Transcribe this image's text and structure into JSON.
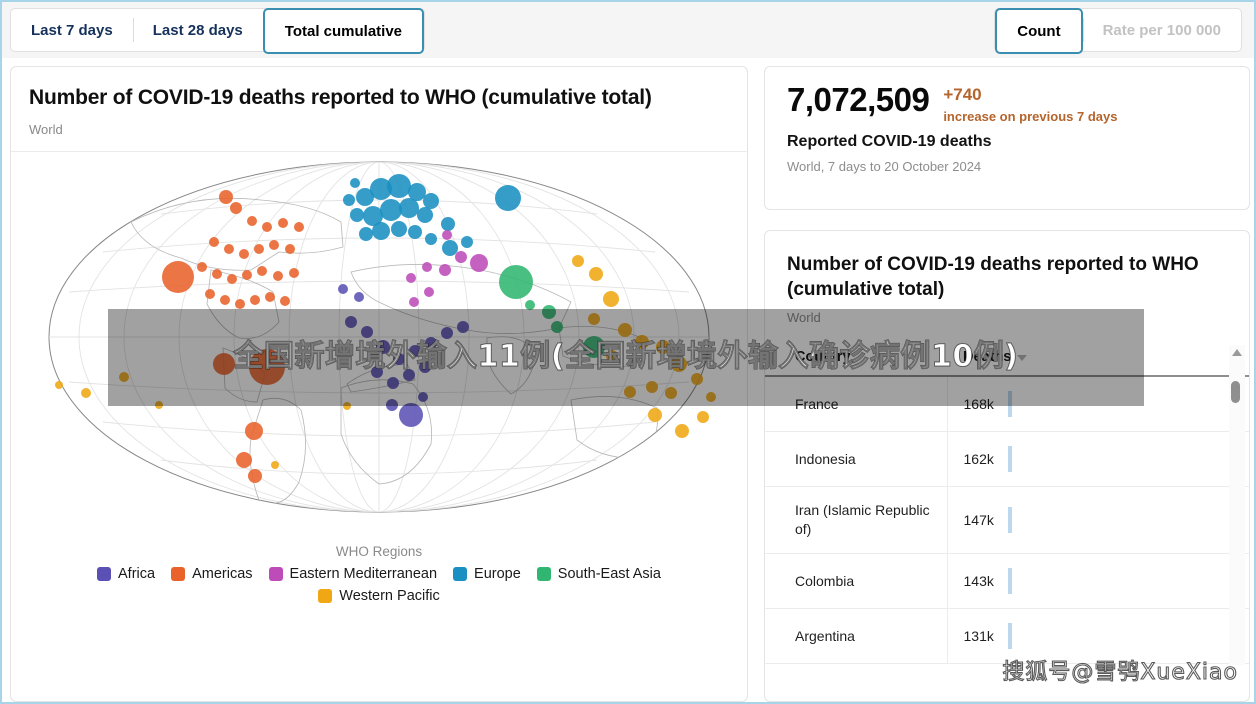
{
  "toolbar": {
    "period_tabs": [
      {
        "label": "Last 7 days",
        "active": false
      },
      {
        "label": "Last 28 days",
        "active": false
      },
      {
        "label": "Total cumulative",
        "active": true
      }
    ],
    "measure_tabs": [
      {
        "label": "Count",
        "active": true,
        "disabled": false
      },
      {
        "label": "Rate per 100 000",
        "active": false,
        "disabled": true
      }
    ]
  },
  "map_panel": {
    "title": "Number of COVID-19 deaths reported to WHO (cumulative total)",
    "subtitle": "World",
    "legend_title": "WHO Regions",
    "legend": [
      {
        "label": "Africa",
        "color": "#5b51b5"
      },
      {
        "label": "Americas",
        "color": "#e8622a"
      },
      {
        "label": "Eastern Mediterranean",
        "color": "#bd4cb8"
      },
      {
        "label": "Europe",
        "color": "#1a8fc1"
      },
      {
        "label": "South-East Asia",
        "color": "#31b671"
      },
      {
        "label": "Western Pacific",
        "color": "#efa713"
      }
    ]
  },
  "stat_panel": {
    "value": "7,072,509",
    "delta": "+740",
    "delta_note": "increase on previous 7 days",
    "label": "Reported COVID-19 deaths",
    "scope": "World, 7 days to 20 October 2024"
  },
  "table_panel": {
    "title": "Number of COVID-19 deaths reported to WHO (cumulative total)",
    "subtitle": "World",
    "columns": [
      "Country",
      "Deaths"
    ],
    "sort_column": "Deaths",
    "sort_direction": "descending",
    "rows": [
      {
        "country": "France",
        "deaths": "168k",
        "bar": 0.34
      },
      {
        "country": "Indonesia",
        "deaths": "162k",
        "bar": 0.33
      },
      {
        "country": "Iran (Islamic Republic of)",
        "deaths": "147k",
        "bar": 0.3
      },
      {
        "country": "Colombia",
        "deaths": "143k",
        "bar": 0.29
      },
      {
        "country": "Argentina",
        "deaths": "131k",
        "bar": 0.27
      }
    ]
  },
  "overlays": {
    "headline": "全国新增境外输入11例(全国新增境外输入确诊病例10例)",
    "watermark": "搜狐号@雪鸮XueXiao"
  },
  "chart_data": {
    "type": "scatter",
    "title": "Number of COVID-19 deaths reported to WHO (cumulative total)",
    "subtitle": "World",
    "projection": "orthographic-globe",
    "encoding": {
      "size": "cumulative deaths",
      "color": "WHO region"
    },
    "legend_position": "bottom",
    "grid": true,
    "series": [
      {
        "name": "Africa",
        "color": "#5b51b5"
      },
      {
        "name": "Americas",
        "color": "#e8622a"
      },
      {
        "name": "Eastern Mediterranean",
        "color": "#bd4cb8"
      },
      {
        "name": "Europe",
        "color": "#1a8fc1"
      },
      {
        "name": "South-East Asia",
        "color": "#31b671"
      },
      {
        "name": "Western Pacific",
        "color": "#efa713"
      }
    ],
    "points": [
      {
        "x": 191,
        "y": 188,
        "r": 20,
        "region": "Americas"
      },
      {
        "x": 167,
        "y": 350,
        "r": 16,
        "region": "Americas"
      },
      {
        "x": 215,
        "y": 270,
        "r": 7,
        "region": "Americas"
      },
      {
        "x": 256,
        "y": 440,
        "r": 18,
        "region": "Americas"
      },
      {
        "x": 213,
        "y": 437,
        "r": 11,
        "region": "Americas"
      },
      {
        "x": 243,
        "y": 504,
        "r": 9,
        "region": "Americas"
      },
      {
        "x": 233,
        "y": 533,
        "r": 8,
        "region": "Americas"
      },
      {
        "x": 244,
        "y": 549,
        "r": 7,
        "region": "Americas"
      },
      {
        "x": 225,
        "y": 281,
        "r": 6,
        "region": "Americas"
      },
      {
        "x": 241,
        "y": 294,
        "r": 5,
        "region": "Americas"
      },
      {
        "x": 256,
        "y": 300,
        "r": 5,
        "region": "Americas"
      },
      {
        "x": 272,
        "y": 296,
        "r": 5,
        "region": "Americas"
      },
      {
        "x": 288,
        "y": 300,
        "r": 5,
        "region": "Americas"
      },
      {
        "x": 203,
        "y": 315,
        "r": 5,
        "region": "Americas"
      },
      {
        "x": 218,
        "y": 322,
        "r": 5,
        "region": "Americas"
      },
      {
        "x": 233,
        "y": 327,
        "r": 5,
        "region": "Americas"
      },
      {
        "x": 248,
        "y": 322,
        "r": 5,
        "region": "Americas"
      },
      {
        "x": 263,
        "y": 318,
        "r": 5,
        "region": "Americas"
      },
      {
        "x": 279,
        "y": 322,
        "r": 5,
        "region": "Americas"
      },
      {
        "x": 191,
        "y": 340,
        "r": 5,
        "region": "Americas"
      },
      {
        "x": 206,
        "y": 347,
        "r": 5,
        "region": "Americas"
      },
      {
        "x": 221,
        "y": 352,
        "r": 5,
        "region": "Americas"
      },
      {
        "x": 236,
        "y": 348,
        "r": 5,
        "region": "Americas"
      },
      {
        "x": 251,
        "y": 344,
        "r": 5,
        "region": "Americas"
      },
      {
        "x": 267,
        "y": 349,
        "r": 5,
        "region": "Americas"
      },
      {
        "x": 283,
        "y": 346,
        "r": 5,
        "region": "Americas"
      },
      {
        "x": 199,
        "y": 367,
        "r": 5,
        "region": "Americas"
      },
      {
        "x": 214,
        "y": 373,
        "r": 5,
        "region": "Americas"
      },
      {
        "x": 229,
        "y": 377,
        "r": 5,
        "region": "Americas"
      },
      {
        "x": 244,
        "y": 373,
        "r": 5,
        "region": "Americas"
      },
      {
        "x": 259,
        "y": 370,
        "r": 5,
        "region": "Americas"
      },
      {
        "x": 274,
        "y": 374,
        "r": 5,
        "region": "Americas"
      },
      {
        "x": 354,
        "y": 270,
        "r": 9,
        "region": "Europe"
      },
      {
        "x": 370,
        "y": 262,
        "r": 11,
        "region": "Europe"
      },
      {
        "x": 388,
        "y": 259,
        "r": 12,
        "region": "Europe"
      },
      {
        "x": 406,
        "y": 265,
        "r": 9,
        "region": "Europe"
      },
      {
        "x": 420,
        "y": 274,
        "r": 8,
        "region": "Europe"
      },
      {
        "x": 362,
        "y": 289,
        "r": 10,
        "region": "Europe"
      },
      {
        "x": 380,
        "y": 283,
        "r": 11,
        "region": "Europe"
      },
      {
        "x": 398,
        "y": 281,
        "r": 10,
        "region": "Europe"
      },
      {
        "x": 414,
        "y": 288,
        "r": 8,
        "region": "Europe"
      },
      {
        "x": 346,
        "y": 288,
        "r": 7,
        "region": "Europe"
      },
      {
        "x": 370,
        "y": 304,
        "r": 9,
        "region": "Europe"
      },
      {
        "x": 388,
        "y": 302,
        "r": 8,
        "region": "Europe"
      },
      {
        "x": 404,
        "y": 305,
        "r": 7,
        "region": "Europe"
      },
      {
        "x": 355,
        "y": 307,
        "r": 7,
        "region": "Europe"
      },
      {
        "x": 497,
        "y": 271,
        "r": 13,
        "region": "Europe"
      },
      {
        "x": 338,
        "y": 273,
        "r": 6,
        "region": "Europe"
      },
      {
        "x": 344,
        "y": 256,
        "r": 5,
        "region": "Europe"
      },
      {
        "x": 437,
        "y": 297,
        "r": 7,
        "region": "Europe"
      },
      {
        "x": 420,
        "y": 312,
        "r": 6,
        "region": "Europe"
      },
      {
        "x": 439,
        "y": 321,
        "r": 8,
        "region": "Europe"
      },
      {
        "x": 456,
        "y": 315,
        "r": 6,
        "region": "Europe"
      },
      {
        "x": 505,
        "y": 355,
        "r": 17,
        "region": "South-East Asia"
      },
      {
        "x": 583,
        "y": 420,
        "r": 11,
        "region": "South-East Asia"
      },
      {
        "x": 538,
        "y": 385,
        "r": 7,
        "region": "South-East Asia"
      },
      {
        "x": 546,
        "y": 400,
        "r": 6,
        "region": "South-East Asia"
      },
      {
        "x": 519,
        "y": 378,
        "r": 5,
        "region": "South-East Asia"
      },
      {
        "x": 468,
        "y": 336,
        "r": 9,
        "region": "Eastern Mediterranean"
      },
      {
        "x": 450,
        "y": 330,
        "r": 6,
        "region": "Eastern Mediterranean"
      },
      {
        "x": 434,
        "y": 343,
        "r": 6,
        "region": "Eastern Mediterranean"
      },
      {
        "x": 416,
        "y": 340,
        "r": 5,
        "region": "Eastern Mediterranean"
      },
      {
        "x": 400,
        "y": 351,
        "r": 5,
        "region": "Eastern Mediterranean"
      },
      {
        "x": 418,
        "y": 365,
        "r": 5,
        "region": "Eastern Mediterranean"
      },
      {
        "x": 403,
        "y": 375,
        "r": 5,
        "region": "Eastern Mediterranean"
      },
      {
        "x": 436,
        "y": 308,
        "r": 5,
        "region": "Eastern Mediterranean"
      },
      {
        "x": 400,
        "y": 488,
        "r": 12,
        "region": "Africa"
      },
      {
        "x": 372,
        "y": 420,
        "r": 7,
        "region": "Africa"
      },
      {
        "x": 388,
        "y": 432,
        "r": 6,
        "region": "Africa"
      },
      {
        "x": 404,
        "y": 424,
        "r": 6,
        "region": "Africa"
      },
      {
        "x": 420,
        "y": 416,
        "r": 6,
        "region": "Africa"
      },
      {
        "x": 436,
        "y": 406,
        "r": 6,
        "region": "Africa"
      },
      {
        "x": 452,
        "y": 400,
        "r": 6,
        "region": "Africa"
      },
      {
        "x": 356,
        "y": 405,
        "r": 6,
        "region": "Africa"
      },
      {
        "x": 340,
        "y": 395,
        "r": 6,
        "region": "Africa"
      },
      {
        "x": 366,
        "y": 445,
        "r": 6,
        "region": "Africa"
      },
      {
        "x": 382,
        "y": 456,
        "r": 6,
        "region": "Africa"
      },
      {
        "x": 398,
        "y": 448,
        "r": 6,
        "region": "Africa"
      },
      {
        "x": 414,
        "y": 440,
        "r": 6,
        "region": "Africa"
      },
      {
        "x": 381,
        "y": 478,
        "r": 6,
        "region": "Africa"
      },
      {
        "x": 412,
        "y": 470,
        "r": 5,
        "region": "Africa"
      },
      {
        "x": 348,
        "y": 370,
        "r": 5,
        "region": "Africa"
      },
      {
        "x": 332,
        "y": 362,
        "r": 5,
        "region": "Africa"
      },
      {
        "x": 614,
        "y": 403,
        "r": 7,
        "region": "Western Pacific"
      },
      {
        "x": 631,
        "y": 415,
        "r": 7,
        "region": "Western Pacific"
      },
      {
        "x": 601,
        "y": 429,
        "r": 6,
        "region": "Western Pacific"
      },
      {
        "x": 652,
        "y": 420,
        "r": 7,
        "region": "Western Pacific"
      },
      {
        "x": 668,
        "y": 437,
        "r": 8,
        "region": "Western Pacific"
      },
      {
        "x": 686,
        "y": 452,
        "r": 6,
        "region": "Western Pacific"
      },
      {
        "x": 660,
        "y": 466,
        "r": 6,
        "region": "Western Pacific"
      },
      {
        "x": 641,
        "y": 460,
        "r": 6,
        "region": "Western Pacific"
      },
      {
        "x": 619,
        "y": 465,
        "r": 6,
        "region": "Western Pacific"
      },
      {
        "x": 585,
        "y": 347,
        "r": 7,
        "region": "Western Pacific"
      },
      {
        "x": 567,
        "y": 334,
        "r": 6,
        "region": "Western Pacific"
      },
      {
        "x": 600,
        "y": 372,
        "r": 8,
        "region": "Western Pacific"
      },
      {
        "x": 583,
        "y": 392,
        "r": 6,
        "region": "Western Pacific"
      },
      {
        "x": 644,
        "y": 488,
        "r": 7,
        "region": "Western Pacific"
      },
      {
        "x": 671,
        "y": 504,
        "r": 7,
        "region": "Western Pacific"
      },
      {
        "x": 692,
        "y": 490,
        "r": 6,
        "region": "Western Pacific"
      },
      {
        "x": 700,
        "y": 470,
        "r": 5,
        "region": "Western Pacific"
      },
      {
        "x": 75,
        "y": 466,
        "r": 5,
        "region": "Western Pacific"
      },
      {
        "x": 113,
        "y": 450,
        "r": 5,
        "region": "Western Pacific"
      },
      {
        "x": 48,
        "y": 458,
        "r": 4,
        "region": "Western Pacific"
      },
      {
        "x": 148,
        "y": 478,
        "r": 4,
        "region": "Western Pacific"
      },
      {
        "x": 264,
        "y": 538,
        "r": 4,
        "region": "Western Pacific"
      },
      {
        "x": 336,
        "y": 479,
        "r": 4,
        "region": "Western Pacific"
      }
    ]
  }
}
